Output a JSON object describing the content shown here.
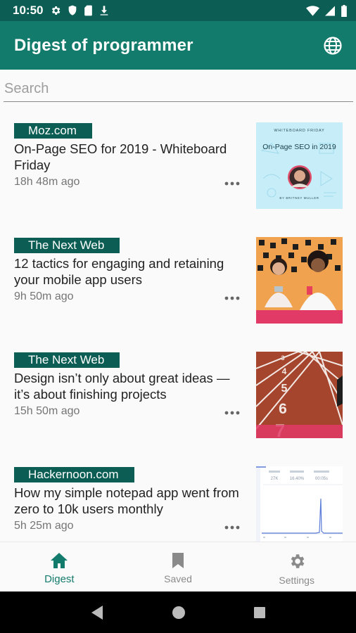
{
  "status_bar": {
    "time": "10:50"
  },
  "app_bar": {
    "title": "Digest of programmer",
    "language_icon": "globe-icon"
  },
  "search": {
    "placeholder": "Search",
    "value": ""
  },
  "articles": [
    {
      "source": "Moz.com",
      "title": "On-Page SEO for 2019 - Whiteboard Friday",
      "time": "18h 48m ago",
      "thumb": {
        "kicker": "WHITEBOARD FRIDAY",
        "headline": "On-Page SEO in 2019",
        "byline": "BY BRITNEY MULLER"
      }
    },
    {
      "source": "The Next Web",
      "title": "12 tactics for engaging and retaining your mobile app users",
      "time": "9h 50m ago"
    },
    {
      "source": "The Next Web",
      "title": "Design isn’t only about great ideas — it’s about finishing projects",
      "time": "15h 50m ago"
    },
    {
      "source": "Hackernoon.com",
      "title": "How my simple notepad app went from zero to 10k users monthly",
      "time": "5h 25m ago",
      "thumb": {
        "stats": [
          "27K",
          "16.40%",
          "00:05s"
        ]
      }
    }
  ],
  "bottom_nav": [
    {
      "label": "Digest",
      "icon": "home-icon",
      "active": true
    },
    {
      "label": "Saved",
      "icon": "bookmark-icon",
      "active": false
    },
    {
      "label": "Settings",
      "icon": "gear-icon",
      "active": false
    }
  ],
  "colors": {
    "primary": "#137b6c",
    "primary_dark": "#0c5e54",
    "badge": "#0c5e54"
  }
}
